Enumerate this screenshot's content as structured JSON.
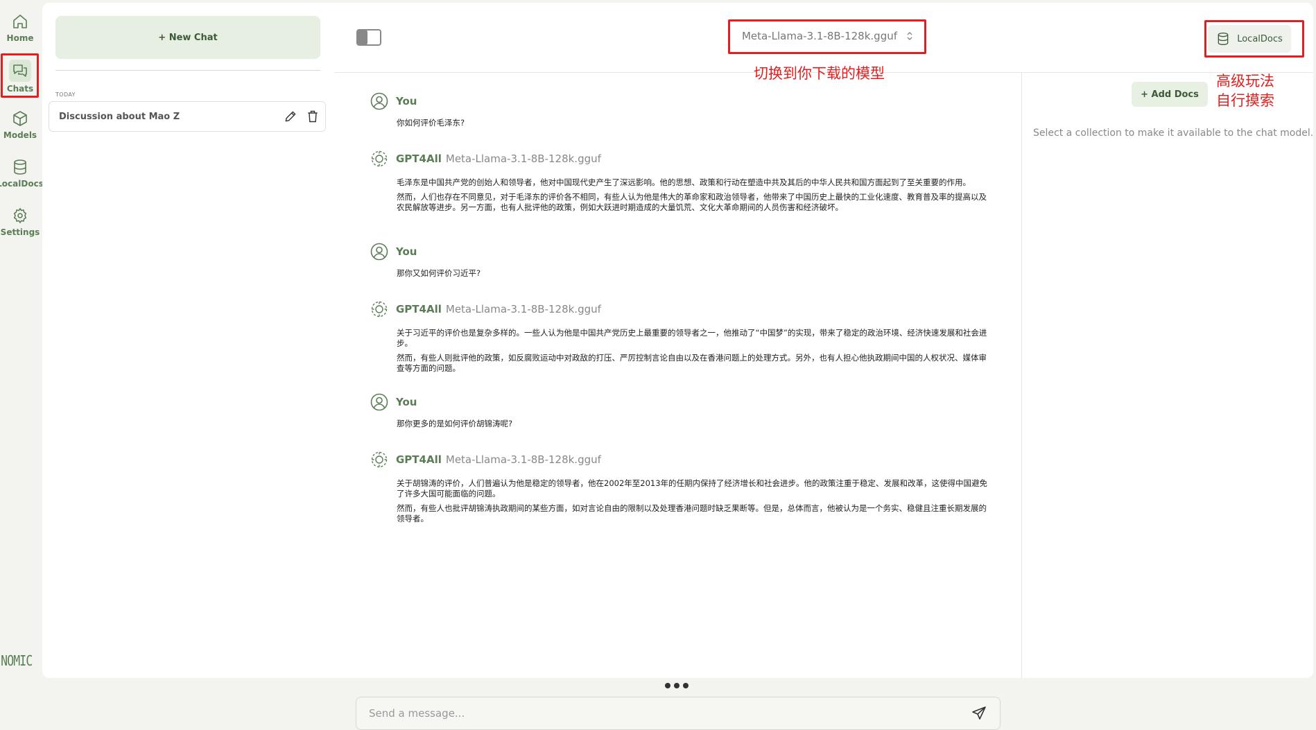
{
  "nav": {
    "items": [
      {
        "label": "Home",
        "icon": "home-icon"
      },
      {
        "label": "Chats",
        "icon": "chat-bubbles-icon"
      },
      {
        "label": "Models",
        "icon": "cube-icon"
      },
      {
        "label": "LocalDocs",
        "icon": "database-icon"
      },
      {
        "label": "Settings",
        "icon": "gear-icon"
      }
    ],
    "brand": "NOMIC"
  },
  "panel": {
    "new_chat_label": "+  New Chat",
    "section_label": "TODAY",
    "chats": [
      {
        "title": "Discussion about Mao Z"
      }
    ]
  },
  "topbar": {
    "model_name": "Meta-Llama-3.1-8B-128k.gguf",
    "localdocs_label": "LocalDocs"
  },
  "annotations": {
    "model_hint": "切换到你下载的模型",
    "docs_hint_line1": "高级玩法",
    "docs_hint_line2": "自行摸索"
  },
  "conversation": {
    "messages": [
      {
        "role": "user",
        "author": "You",
        "paragraphs": [
          "你如何评价毛泽东?"
        ]
      },
      {
        "role": "assistant",
        "author": "GPT4All",
        "model": "Meta-Llama-3.1-8B-128k.gguf",
        "paragraphs": [
          "毛泽东是中国共产党的创始人和领导者，他对中国现代史产生了深远影响。他的思想、政策和行动在塑造中共及其后的中华人民共和国方面起到了至关重要的作用。",
          "然而，人们也存在不同意见，对于毛泽东的评价各不相同，有些人认为他是伟大的革命家和政治领导者，他带来了中国历史上最快的工业化速度、教育普及率的提高以及农民解放等进步。另一方面，也有人批评他的政策，例如大跃进时期造成的大量饥荒、文化大革命期间的人员伤害和经济破坏。"
        ]
      },
      {
        "role": "user",
        "author": "You",
        "paragraphs": [
          "那你又如何评价习近平?"
        ]
      },
      {
        "role": "assistant",
        "author": "GPT4All",
        "model": "Meta-Llama-3.1-8B-128k.gguf",
        "paragraphs": [
          "关于习近平的评价也是复杂多样的。一些人认为他是中国共产党历史上最重要的领导者之一，他推动了“中国梦”的实现，带来了稳定的政治环境、经济快速发展和社会进步。",
          "然而，有些人则批评他的政策，如反腐败运动中对政敌的打压、严厉控制言论自由以及在香港问题上的处理方式。另外，也有人担心他执政期间中国的人权状况、媒体审查等方面的问题。"
        ]
      },
      {
        "role": "user",
        "author": "You",
        "paragraphs": [
          "那你更多的是如何评价胡锦涛呢?"
        ]
      },
      {
        "role": "assistant",
        "author": "GPT4All",
        "model": "Meta-Llama-3.1-8B-128k.gguf",
        "paragraphs": [
          "关于胡锦涛的评价，人们普遍认为他是稳定的领导者，他在2002年至2013年的任期内保持了经济增长和社会进步。他的政策注重于稳定、发展和改革，这使得中国避免了许多大国可能面临的问题。",
          "然而，有些人也批评胡锦涛执政期间的某些方面，如对言论自由的限制以及处理香港问题时缺乏果断等。但是，总体而言，他被认为是一个务实、稳健且注重长期发展的领导者。"
        ]
      }
    ]
  },
  "composer": {
    "placeholder": "Send a message..."
  },
  "docs_panel": {
    "add_docs_label": "+  Add Docs",
    "hint": "Select a collection to make it available to the chat model."
  },
  "colors": {
    "accent": "#5a7d55",
    "highlight": "#e02020",
    "button_bg": "#e6efe2"
  }
}
